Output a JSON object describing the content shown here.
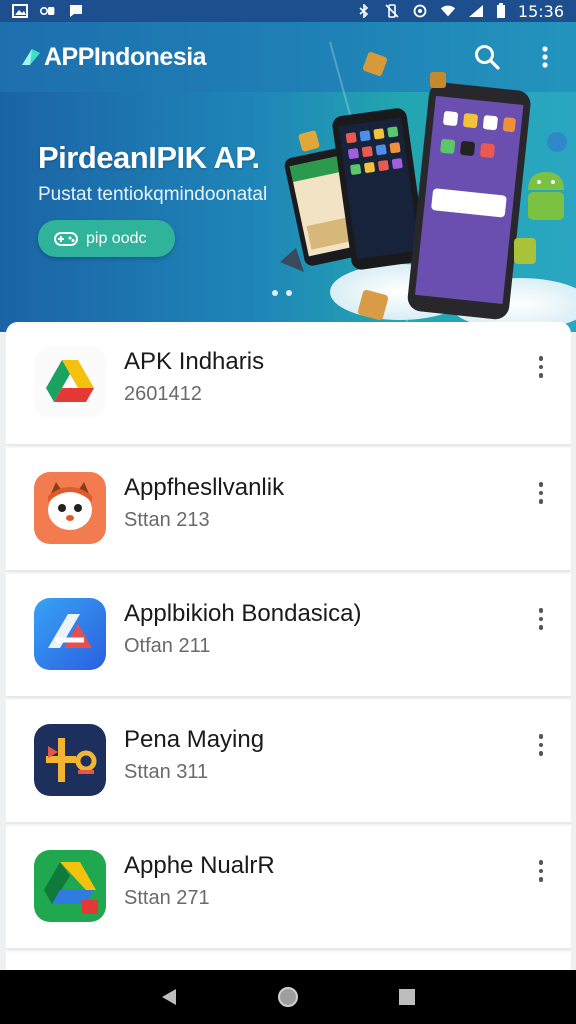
{
  "status_bar": {
    "time": "15:36"
  },
  "app_bar": {
    "logo_text": "APPIndonesia"
  },
  "banner": {
    "title": "PirdeanIPIK AP.",
    "subtitle": "Pustat tentiokqmindoonatal",
    "button_label": "pip oodc"
  },
  "apps": [
    {
      "name": "APK Indharis",
      "meta": "2601412",
      "icon": "drive-icon"
    },
    {
      "name": "Appfhesllvanlik",
      "meta": "Sttan 213",
      "icon": "cat-app-icon"
    },
    {
      "name": "Applbikioh Bondasica)",
      "meta": "Otfan 211",
      "icon": "blue-app-icon"
    },
    {
      "name": "Pena Maying",
      "meta": "Sttan 311",
      "icon": "puzzle-app-icon"
    },
    {
      "name": "Apphe NualrR",
      "meta": "Sttan 271",
      "icon": "drive-icon"
    }
  ],
  "colors": {
    "app_bar": "#1e6fae",
    "banner_button": "#2fb39a",
    "nav_bar": "#000000"
  }
}
